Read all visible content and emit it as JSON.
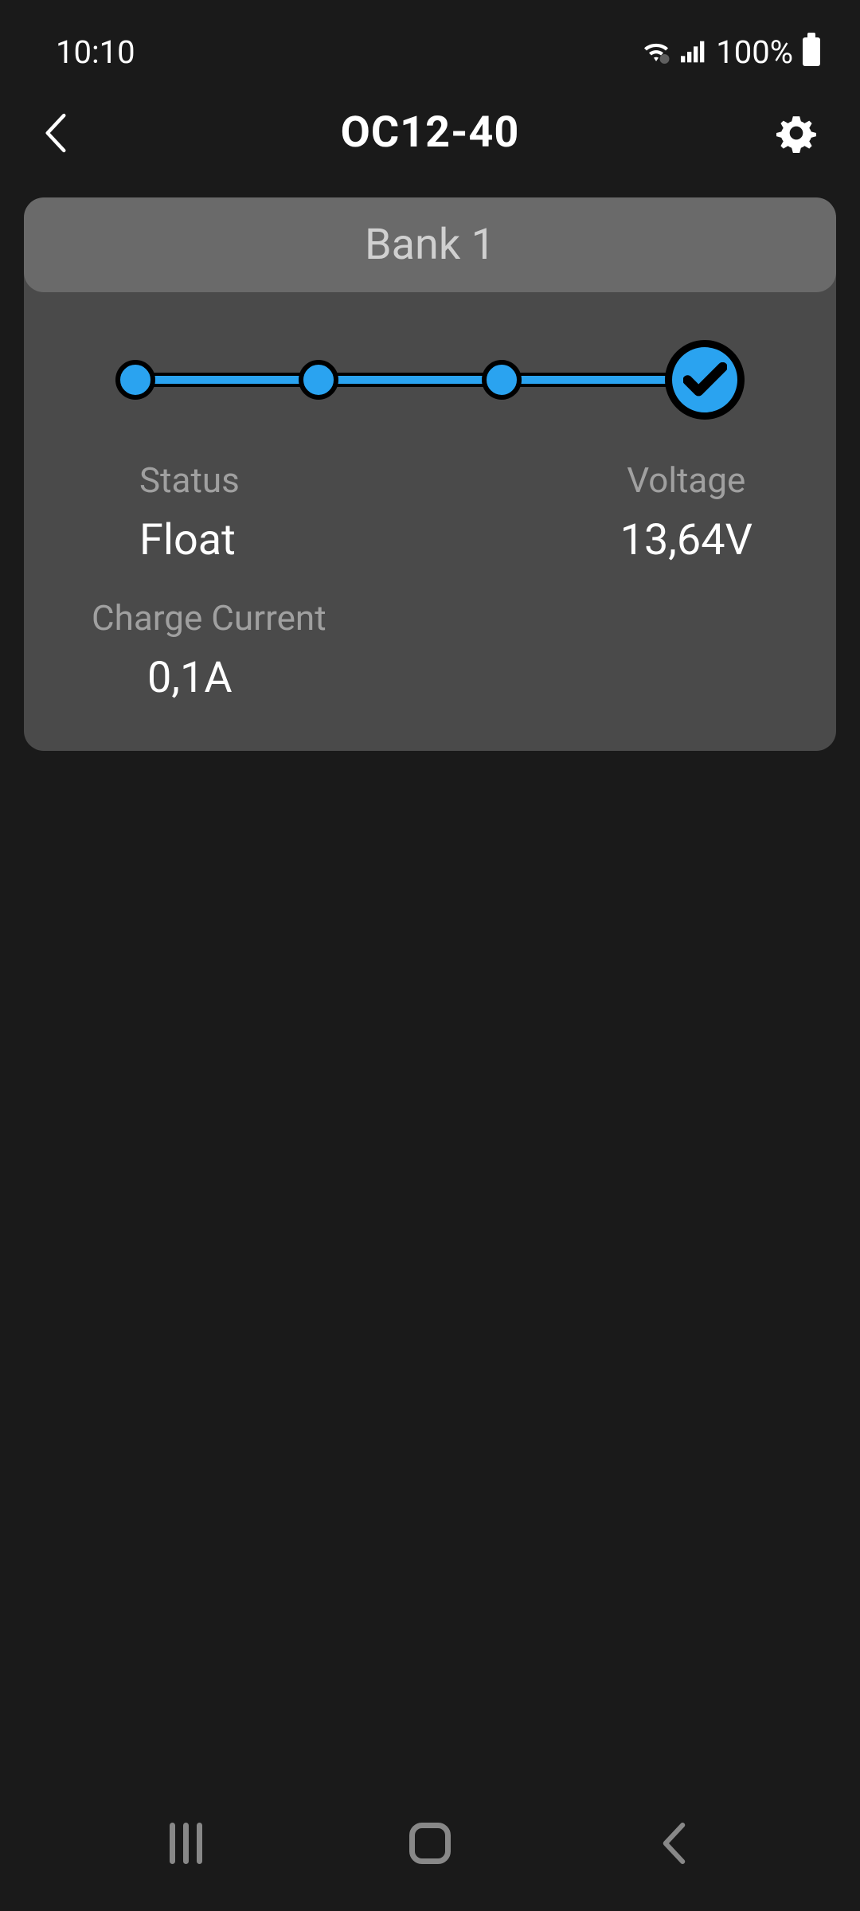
{
  "statusBar": {
    "time": "10:10",
    "batteryPercent": "100%"
  },
  "header": {
    "title": "OC12-40"
  },
  "card": {
    "title": "Bank 1",
    "status": {
      "label": "Status",
      "value": "Float"
    },
    "voltage": {
      "label": "Voltage",
      "value": "13,64V"
    },
    "chargeCurrent": {
      "label": "Charge Current",
      "value": "0,1A"
    }
  },
  "colors": {
    "accent": "#2aa3f0",
    "background": "#1a1a1a",
    "cardBg": "#4a4a4a",
    "cardHeaderBg": "#6a6a6a"
  }
}
